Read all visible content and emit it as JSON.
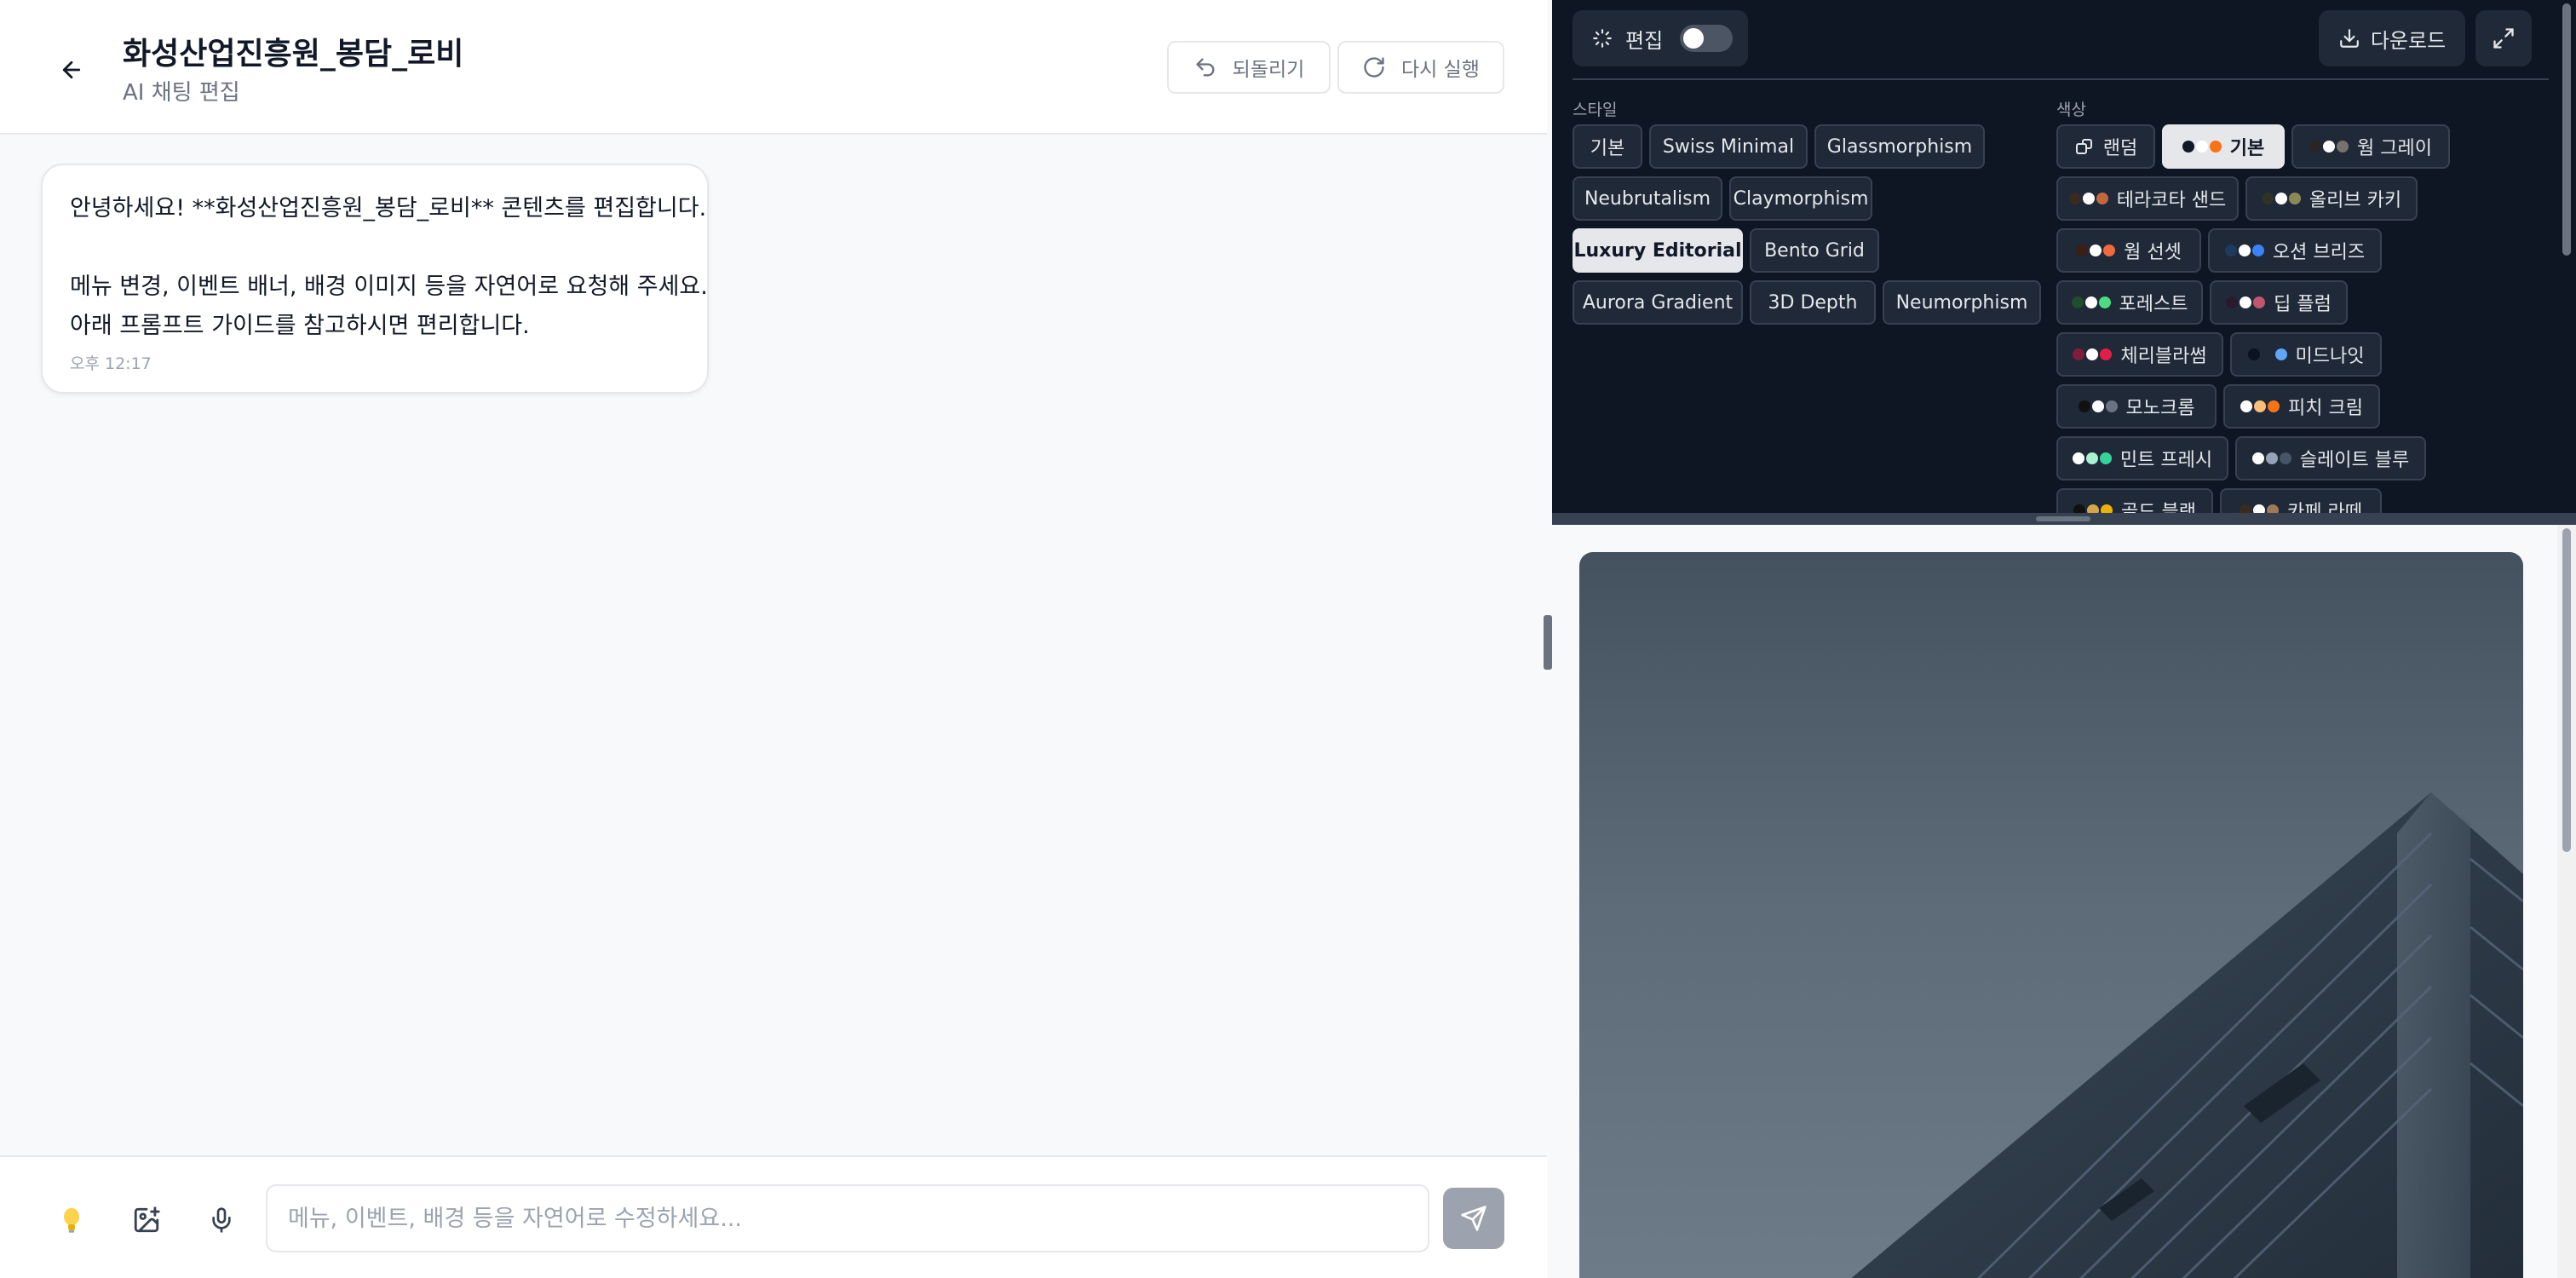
{
  "header": {
    "title": "화성산업진흥원_봉담_로비",
    "subtitle": "AI 채팅 편집",
    "undo_label": "되돌리기",
    "redo_label": "다시 실행"
  },
  "chat": {
    "messages": [
      {
        "line1": "안녕하세요! **화성산업진흥원_봉담_로비** 콘텐츠를 편집합니다.",
        "line2": "메뉴 변경, 이벤트 배너, 배경 이미지 등을 자연어로 요청해 주세요.",
        "line3": "아래 프롬프트 가이드를 참고하시면 편리합니다.",
        "time": "오후 12:17"
      }
    ]
  },
  "input": {
    "placeholder": "메뉴, 이벤트, 배경 등을 자연어로 수정하세요..."
  },
  "toolbar": {
    "edit_label": "편집",
    "edit_on": false,
    "download_label": "다운로드"
  },
  "styles": {
    "label": "스타일",
    "items": [
      "기본",
      "Swiss Minimal",
      "Glassmorphism",
      "Neubrutalism",
      "Claymorphism",
      "Luxury Editorial",
      "Bento Grid",
      "Aurora Gradient",
      "3D Depth",
      "Neumorphism"
    ],
    "selected": "Luxury Editorial"
  },
  "colors": {
    "label": "색상",
    "selected": "기본",
    "items": [
      {
        "label": "랜덤",
        "dots": []
      },
      {
        "label": "기본",
        "dots": [
          "#111827",
          "#ffffff",
          "#f97316"
        ]
      },
      {
        "label": "웜 그레이",
        "dots": [
          "#292524",
          "#ffffff",
          "#78716c"
        ]
      },
      {
        "label": "테라코타 샌드",
        "dots": [
          "#3b2a22",
          "#ffffff",
          "#c2673f"
        ]
      },
      {
        "label": "올리브 카키",
        "dots": [
          "#2f3324",
          "#ffffff",
          "#8a8a55"
        ]
      },
      {
        "label": "웜 선셋",
        "dots": [
          "#3a1f17",
          "#ffffff",
          "#ef6b3a"
        ]
      },
      {
        "label": "오션 브리즈",
        "dots": [
          "#1e3a5f",
          "#ffffff",
          "#3b82f6"
        ]
      },
      {
        "label": "포레스트",
        "dots": [
          "#1f4d2e",
          "#ffffff",
          "#4ade80"
        ]
      },
      {
        "label": "딥 플럼",
        "dots": [
          "#2a1a2e",
          "#ffffff",
          "#c0576f"
        ]
      },
      {
        "label": "체리블라썸",
        "dots": [
          "#7f1d3a",
          "#ffffff",
          "#e11d48"
        ]
      },
      {
        "label": "미드나잇",
        "dots": [
          "#0b1220",
          "#1f2937",
          "#60a5fa"
        ]
      },
      {
        "label": "모노크롬",
        "dots": [
          "#111111",
          "#ffffff",
          "#6b7280"
        ]
      },
      {
        "label": "피치 크림",
        "dots": [
          "#ffffff",
          "#fbbf77",
          "#f97316"
        ]
      },
      {
        "label": "민트 프레시",
        "dots": [
          "#ffffff",
          "#a7f3d0",
          "#34d399"
        ]
      },
      {
        "label": "슬레이트 블루",
        "dots": [
          "#ffffff",
          "#94a3b8",
          "#475569"
        ]
      },
      {
        "label": "골드 블랙",
        "dots": [
          "#111111",
          "#d4a64a",
          "#eab308"
        ]
      },
      {
        "label": "카페 라떼",
        "dots": [
          "#3b2a20",
          "#ffffff",
          "#a0785a"
        ]
      }
    ]
  }
}
